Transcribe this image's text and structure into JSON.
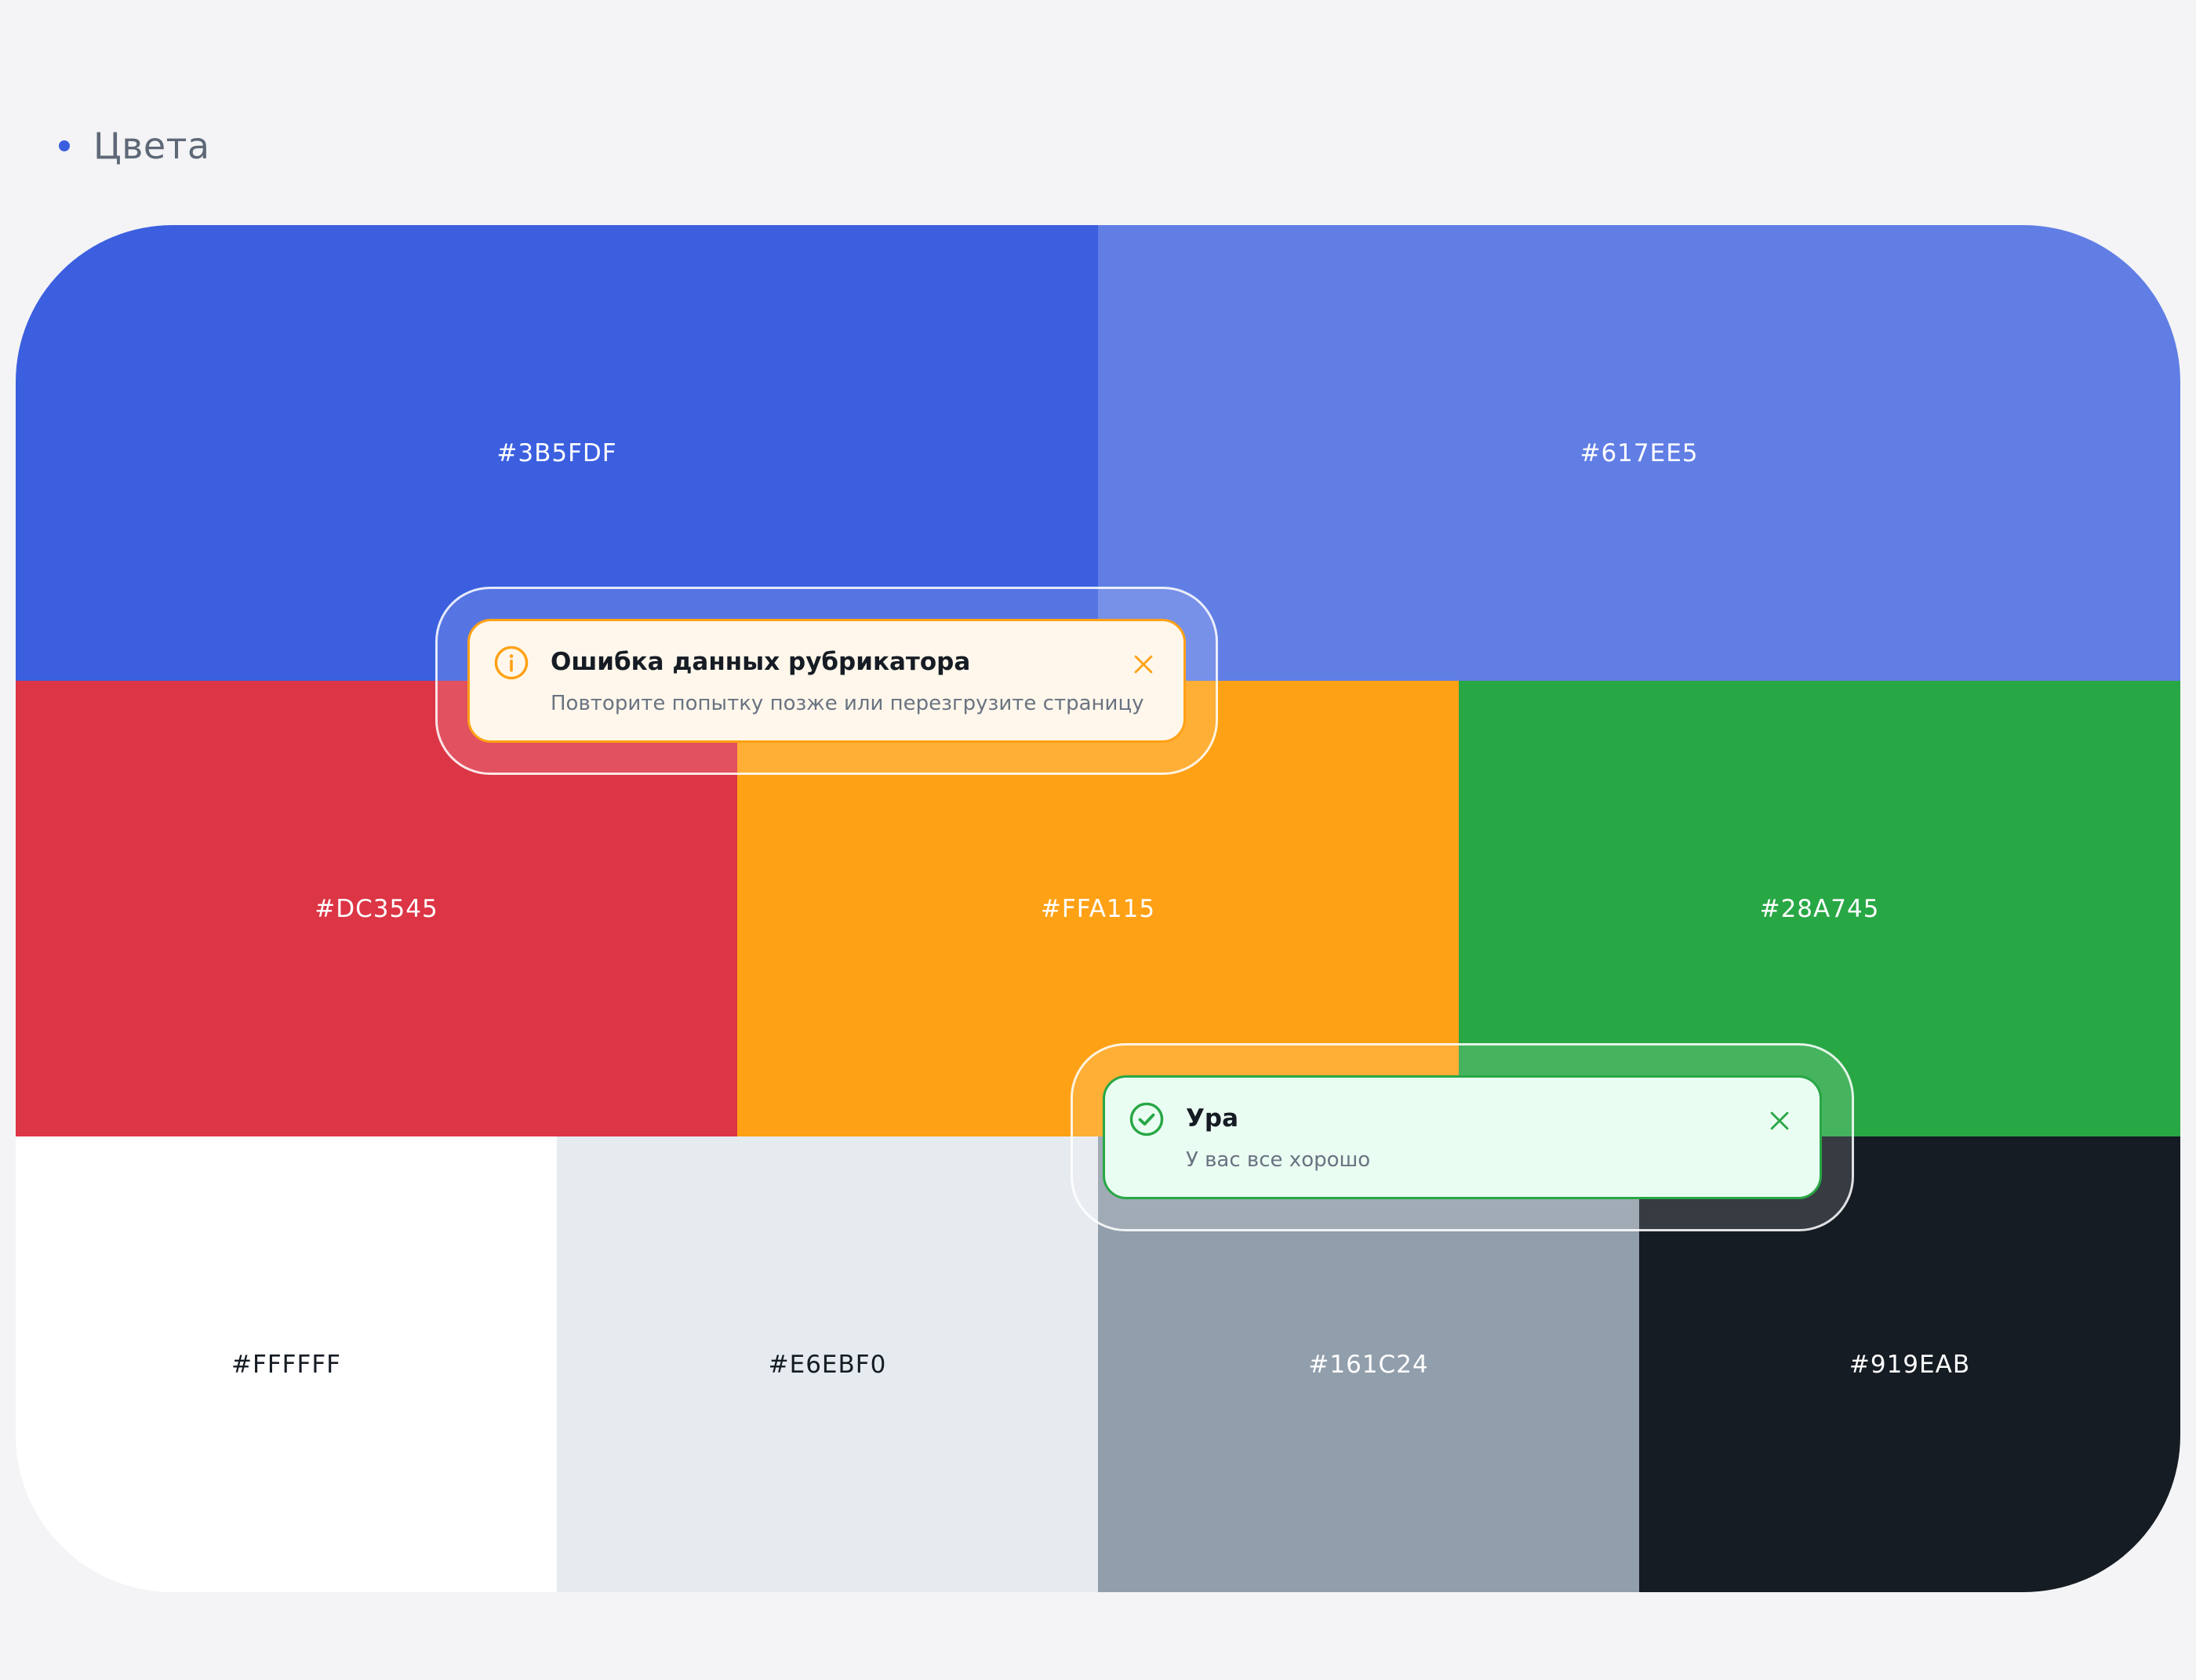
{
  "section": {
    "title": "Цвета",
    "bullet_color": "#3B5FDF"
  },
  "palette": {
    "rows": [
      [
        {
          "label": "#3B5FDF",
          "bg": "#3B5FDF",
          "fg": "#FFFFFF"
        },
        {
          "label": "#617EE5",
          "bg": "#617EE5",
          "fg": "#FFFFFF"
        }
      ],
      [
        {
          "label": "#DC3545",
          "bg": "#DC3545",
          "fg": "#FFFFFF"
        },
        {
          "label": "#FFA115",
          "bg": "#FFA115",
          "fg": "#FFFFFF"
        },
        {
          "label": "#28A745",
          "bg": "#28A745",
          "fg": "#FFFFFF"
        }
      ],
      [
        {
          "label": "#FFFFFF",
          "bg": "#FFFFFF",
          "fg": "#161C24"
        },
        {
          "label": "#E6EBF0",
          "bg": "#E6EBF0",
          "fg": "#161C24"
        },
        {
          "label": "#161C24",
          "bg": "#919EAB",
          "fg": "#FFFFFF"
        },
        {
          "label": "#919EAB",
          "bg": "#161C24",
          "fg": "#FFFFFF"
        }
      ]
    ]
  },
  "toasts": {
    "warning": {
      "title": "Ошибка данных рубрикатора",
      "text": "Повторите попытку позже или перезгрузите страницу",
      "icon": "info-circle-icon",
      "accent": "#FFA115"
    },
    "success": {
      "title": "Ура",
      "text": "У вас все хорошо",
      "icon": "check-circle-icon",
      "accent": "#28A745"
    }
  }
}
